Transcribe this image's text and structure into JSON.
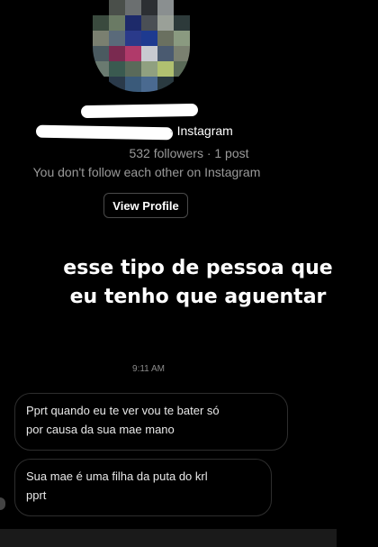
{
  "profile": {
    "handle_suffix": "Instagram",
    "separator": "·",
    "followers_line": "532 followers · 1 post",
    "follow_status": "You don't follow each other on Instagram",
    "view_profile_label": "View Profile"
  },
  "overlay_caption": {
    "line1": "esse tipo de pessoa que",
    "line2": "eu tenho que aguentar"
  },
  "thread": {
    "timestamp": "9:11 AM",
    "messages": [
      {
        "line1": "Pprt quando eu te ver vou te bater só",
        "line2": "por causa da sua mae mano"
      },
      {
        "line1": "Sua mae é uma filha da puta do krl",
        "line2": "pprt"
      }
    ]
  },
  "colors": {
    "background": "#000000",
    "muted_text": "#9a9a9a",
    "bubble_border": "#2e2e2e"
  }
}
